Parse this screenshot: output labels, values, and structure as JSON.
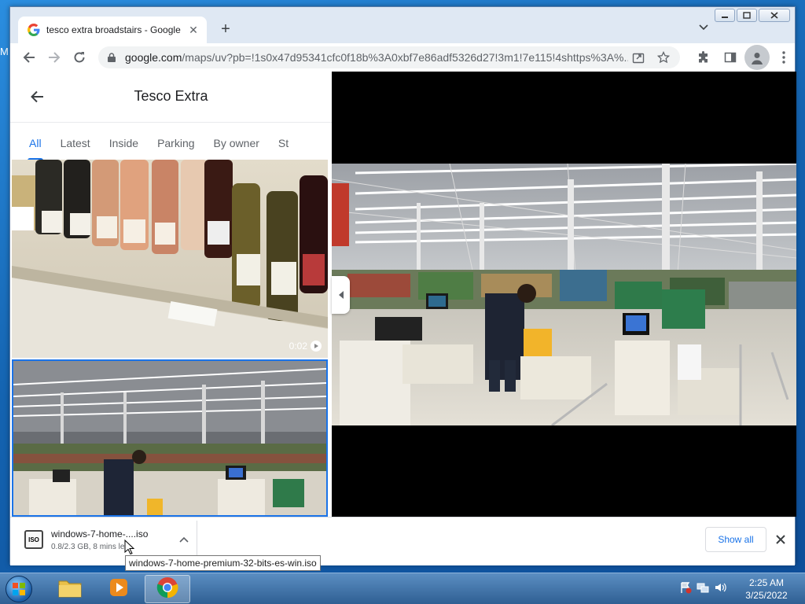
{
  "desktop": {
    "edge_text": "M"
  },
  "browser": {
    "tab_title": "tesco extra broadstairs - Google",
    "url_host": "google.com",
    "url_path": "/maps/uv?pb=!1s0x47d95341cfc0f18b%3A0xbf7e86adf5326d27!3m1!7e115!4shttps%3A%..."
  },
  "place": {
    "title": "Tesco Extra",
    "tabs": [
      {
        "label": "All"
      },
      {
        "label": "Latest"
      },
      {
        "label": "Inside"
      },
      {
        "label": "Parking"
      },
      {
        "label": "By owner"
      },
      {
        "label": "St"
      }
    ],
    "active_tab": "All",
    "video_duration": "0:02"
  },
  "downloads": {
    "file_name": "windows-7-home-....iso",
    "status": "0.8/2.3 GB, 8 mins left",
    "show_all": "Show all",
    "tooltip": "windows-7-home-premium-32-bits-es-win.iso",
    "icon_text": "ISO"
  },
  "taskbar": {
    "time": "2:25 AM",
    "date": "3/25/2022"
  },
  "colors": {
    "accent": "#1a73e8"
  }
}
